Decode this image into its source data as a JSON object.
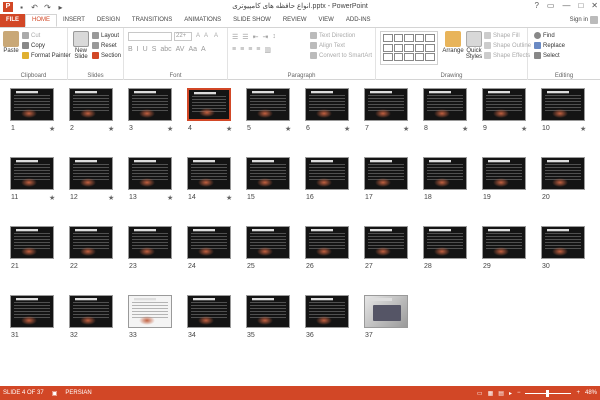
{
  "window": {
    "title": "انواع حافظه های کامپیوتری.pptx - PowerPoint",
    "controls": [
      "?",
      "▭",
      "—",
      "□",
      "✕"
    ],
    "signin": "Sign in"
  },
  "qat": {
    "app_icon": "P",
    "icons": [
      "save-icon",
      "undo-icon",
      "redo-icon",
      "start-slideshow-icon"
    ]
  },
  "tabs": [
    "FILE",
    "HOME",
    "INSERT",
    "DESIGN",
    "TRANSITIONS",
    "ANIMATIONS",
    "SLIDE SHOW",
    "REVIEW",
    "VIEW",
    "ADD-INS"
  ],
  "active_tab": "HOME",
  "ribbon": {
    "clipboard": {
      "label": "Clipboard",
      "paste": "Paste",
      "cut": "Cut",
      "copy": "Copy",
      "format_painter": "Format Painter"
    },
    "slides": {
      "label": "Slides",
      "new_slide": "New Slide",
      "layout": "Layout",
      "reset": "Reset",
      "section": "Section"
    },
    "font": {
      "label": "Font",
      "font_size": "22+",
      "format_buttons": [
        "B",
        "I",
        "U",
        "S",
        "abc",
        "AV",
        "Aa",
        "A"
      ]
    },
    "paragraph": {
      "label": "Paragraph",
      "text_direction": "Text Direction",
      "align_text": "Align Text",
      "convert_smartart": "Convert to SmartArt"
    },
    "drawing": {
      "label": "Drawing",
      "arrange": "Arrange",
      "quick_styles": "Quick Styles",
      "shape_fill": "Shape Fill",
      "shape_outline": "Shape Outline",
      "shape_effects": "Shape Effects"
    },
    "editing": {
      "label": "Editing",
      "find": "Find",
      "replace": "Replace",
      "select": "Select"
    }
  },
  "slides": [
    {
      "n": "1",
      "star": true
    },
    {
      "n": "2",
      "star": true
    },
    {
      "n": "3",
      "star": true
    },
    {
      "n": "4",
      "star": true,
      "selected": true
    },
    {
      "n": "5",
      "star": true
    },
    {
      "n": "6",
      "star": true
    },
    {
      "n": "7",
      "star": true
    },
    {
      "n": "8",
      "star": true
    },
    {
      "n": "9",
      "star": true
    },
    {
      "n": "10",
      "star": true
    },
    {
      "n": "11",
      "star": true
    },
    {
      "n": "12",
      "star": true
    },
    {
      "n": "13",
      "star": true
    },
    {
      "n": "14",
      "star": true
    },
    {
      "n": "15"
    },
    {
      "n": "16"
    },
    {
      "n": "17"
    },
    {
      "n": "18"
    },
    {
      "n": "19"
    },
    {
      "n": "20"
    },
    {
      "n": "21"
    },
    {
      "n": "22"
    },
    {
      "n": "23"
    },
    {
      "n": "24"
    },
    {
      "n": "25"
    },
    {
      "n": "26"
    },
    {
      "n": "27"
    },
    {
      "n": "28"
    },
    {
      "n": "29"
    },
    {
      "n": "30"
    },
    {
      "n": "31"
    },
    {
      "n": "32"
    },
    {
      "n": "33",
      "white": true
    },
    {
      "n": "34"
    },
    {
      "n": "35"
    },
    {
      "n": "36"
    },
    {
      "n": "37",
      "photo": true
    }
  ],
  "status": {
    "slide_info": "SLIDE 4 OF 37",
    "language": "PERSIAN",
    "zoom": "48%",
    "zoom_level": 0.48
  },
  "colors": {
    "accent": "#d24726"
  }
}
